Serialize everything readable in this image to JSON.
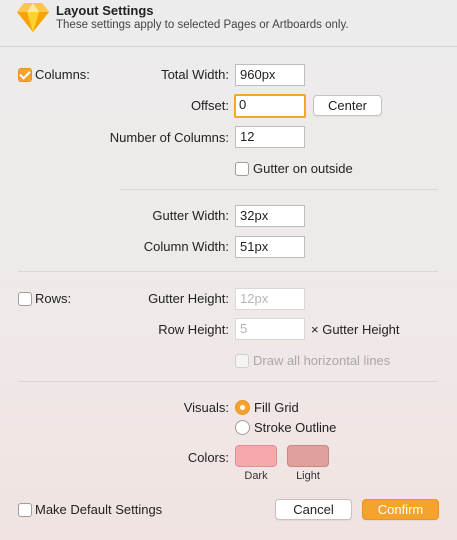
{
  "header": {
    "title": "Layout Settings",
    "subtitle": "These settings apply to selected Pages or Artboards only."
  },
  "columns": {
    "checkbox_label": "Columns:",
    "checked": true,
    "total_width_label": "Total Width:",
    "total_width_value": "960px",
    "offset_label": "Offset:",
    "offset_value": "0",
    "center_button": "Center",
    "number_label": "Number of Columns:",
    "number_value": "12",
    "gutter_outside_label": "Gutter on outside",
    "gutter_outside_checked": false,
    "gutter_width_label": "Gutter Width:",
    "gutter_width_value": "32px",
    "column_width_label": "Column Width:",
    "column_width_value": "51px"
  },
  "rows": {
    "checkbox_label": "Rows:",
    "checked": false,
    "gutter_height_label": "Gutter Height:",
    "gutter_height_value": "12px",
    "row_height_label": "Row Height:",
    "row_height_value": "5",
    "row_height_suffix": "× Gutter Height",
    "draw_lines_label": "Draw all horizontal lines",
    "draw_lines_checked": false
  },
  "visuals": {
    "label": "Visuals:",
    "options": [
      "Fill Grid",
      "Stroke Outline"
    ],
    "selected": "Fill Grid"
  },
  "colors": {
    "label": "Colors:",
    "dark_label": "Dark",
    "light_label": "Light",
    "dark_color": "#f6a9ad",
    "light_color": "#e0a09c"
  },
  "footer": {
    "default_label": "Make Default Settings",
    "default_checked": false,
    "cancel_button": "Cancel",
    "confirm_button": "Confirm"
  },
  "accent_color": "#f5a32d",
  "icons": {
    "logo": "sketch-diamond-icon"
  }
}
